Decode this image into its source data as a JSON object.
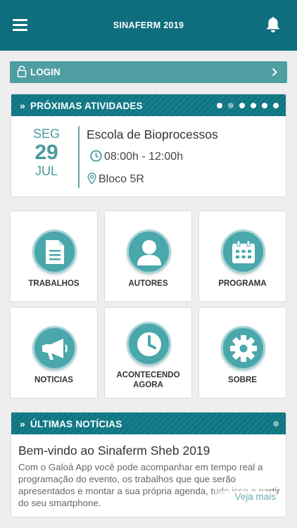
{
  "app": {
    "title": "SINAFERM 2019"
  },
  "login": {
    "label": "LOGIN"
  },
  "atividades": {
    "title": "PRÓXIMAS ATIVIDADES",
    "chevrons": "»",
    "event": {
      "dow": "SEG",
      "day": "29",
      "month": "JUL",
      "title": "Escola de Bioprocessos",
      "time": "08:00h - 12:00h",
      "location": "Bloco 5R"
    }
  },
  "tiles": [
    {
      "label": "TRABALHOS",
      "icon": "document-icon"
    },
    {
      "label": "AUTORES",
      "icon": "person-icon"
    },
    {
      "label": "PROGRAMA",
      "icon": "calendar-icon"
    },
    {
      "label": "NOTICIAS",
      "icon": "megaphone-icon"
    },
    {
      "label_line1": "ACONTECENDO",
      "label_line2": "AGORA",
      "icon": "clock-icon"
    },
    {
      "label": "SOBRE",
      "icon": "gear-icon"
    }
  ],
  "noticias": {
    "title": "ÚLTIMAS NOTÍCIAS",
    "chevrons": "»",
    "item": {
      "title": "Bem-vindo ao Sinaferm Sheb 2019",
      "body": "Com o Galoá App você pode acompanhar em tempo real a programação do evento, os trabalhos que que serão apresentados e montar a sua própria agenda, tudo isso a partir do seu smartphone.",
      "more": "Veja mais"
    }
  },
  "colors": {
    "primary": "#0e6e7d",
    "accent": "#4aa7ab",
    "login": "#4f9ea1"
  }
}
